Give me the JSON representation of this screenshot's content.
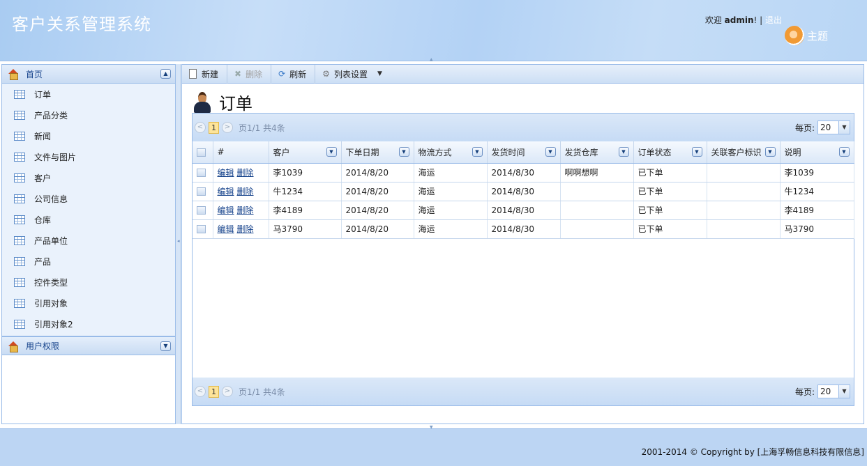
{
  "header": {
    "app_title": "客户关系管理系统",
    "welcome": "欢迎 ",
    "username": "admin",
    "exclaim": "! | ",
    "logout": "退出",
    "theme_label": "主题"
  },
  "sidebar": {
    "section1_title": "首页",
    "items": [
      {
        "label": "订单"
      },
      {
        "label": "产品分类"
      },
      {
        "label": "新闻"
      },
      {
        "label": "文件与图片"
      },
      {
        "label": "客户"
      },
      {
        "label": "公司信息"
      },
      {
        "label": "仓库"
      },
      {
        "label": "产品单位"
      },
      {
        "label": "产品"
      },
      {
        "label": "控件类型"
      },
      {
        "label": "引用对象"
      },
      {
        "label": "引用对象2"
      }
    ],
    "section2_title": "用户权限"
  },
  "toolbar": {
    "new_label": "新建",
    "delete_label": "删除",
    "refresh_label": "刷新",
    "columns_label": "列表设置"
  },
  "page": {
    "title": "订单"
  },
  "pager": {
    "current_page": "1",
    "info": "页1/1 共4条",
    "page_size_label": "每页:",
    "page_size": "20"
  },
  "table": {
    "columns": [
      "#",
      "客户",
      "下单日期",
      "物流方式",
      "发货时间",
      "发货仓库",
      "订单状态",
      "关联客户标识",
      "说明"
    ],
    "edit_label": "编辑",
    "delete_label": "删除",
    "rows": [
      {
        "customer": "李1039",
        "order_date": "2014/8/20",
        "shipping": "海运",
        "ship_time": "2014/8/30",
        "warehouse": "啊啊想啊",
        "status": "已下单",
        "related": "",
        "note": "李1039"
      },
      {
        "customer": "牛1234",
        "order_date": "2014/8/20",
        "shipping": "海运",
        "ship_time": "2014/8/30",
        "warehouse": "",
        "status": "已下单",
        "related": "",
        "note": "牛1234"
      },
      {
        "customer": "李4189",
        "order_date": "2014/8/20",
        "shipping": "海运",
        "ship_time": "2014/8/30",
        "warehouse": "",
        "status": "已下单",
        "related": "",
        "note": "李4189"
      },
      {
        "customer": "马3790",
        "order_date": "2014/8/20",
        "shipping": "海运",
        "ship_time": "2014/8/30",
        "warehouse": "",
        "status": "已下单",
        "related": "",
        "note": "马3790"
      }
    ]
  },
  "footer": {
    "copyright": "2001-2014 © Copyright by [上海孚畅信息科技有限信息]"
  }
}
